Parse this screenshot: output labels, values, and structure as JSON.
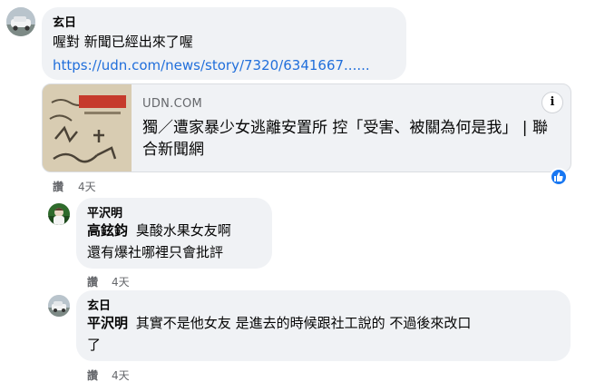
{
  "comments": [
    {
      "author": "玄日",
      "text": "喔對 新聞已經出來了喔",
      "link": "https://udn.com/news/story/7320/6341667......",
      "preview": {
        "domain": "UDN.COM",
        "title": "獨／遭家暴少女逃離安置所 控「受害、被關為何是我」 | 聯合新聞網",
        "info_icon": "i"
      },
      "like_label": "讚",
      "time": "4天"
    }
  ],
  "replies": [
    {
      "author": "平沢明",
      "mention": "高鉉鈞",
      "text_line1": "臭酸水果女友啊",
      "text_line2": "還有爆社哪裡只會批評",
      "like_label": "讚",
      "time": "4天"
    },
    {
      "author": "玄日",
      "mention": "平沢明",
      "text_line1": "其實不是他女友 是進去的時候跟社工說的 不過後來改口",
      "text_line2": "了",
      "like_label": "讚",
      "time": "4天"
    }
  ],
  "icons": {
    "reaction": "like-icon",
    "info": "info-icon"
  },
  "colors": {
    "bubble": "#f0f2f5",
    "link": "#216fdb",
    "meta": "#65676b",
    "like": "#1877f2"
  }
}
